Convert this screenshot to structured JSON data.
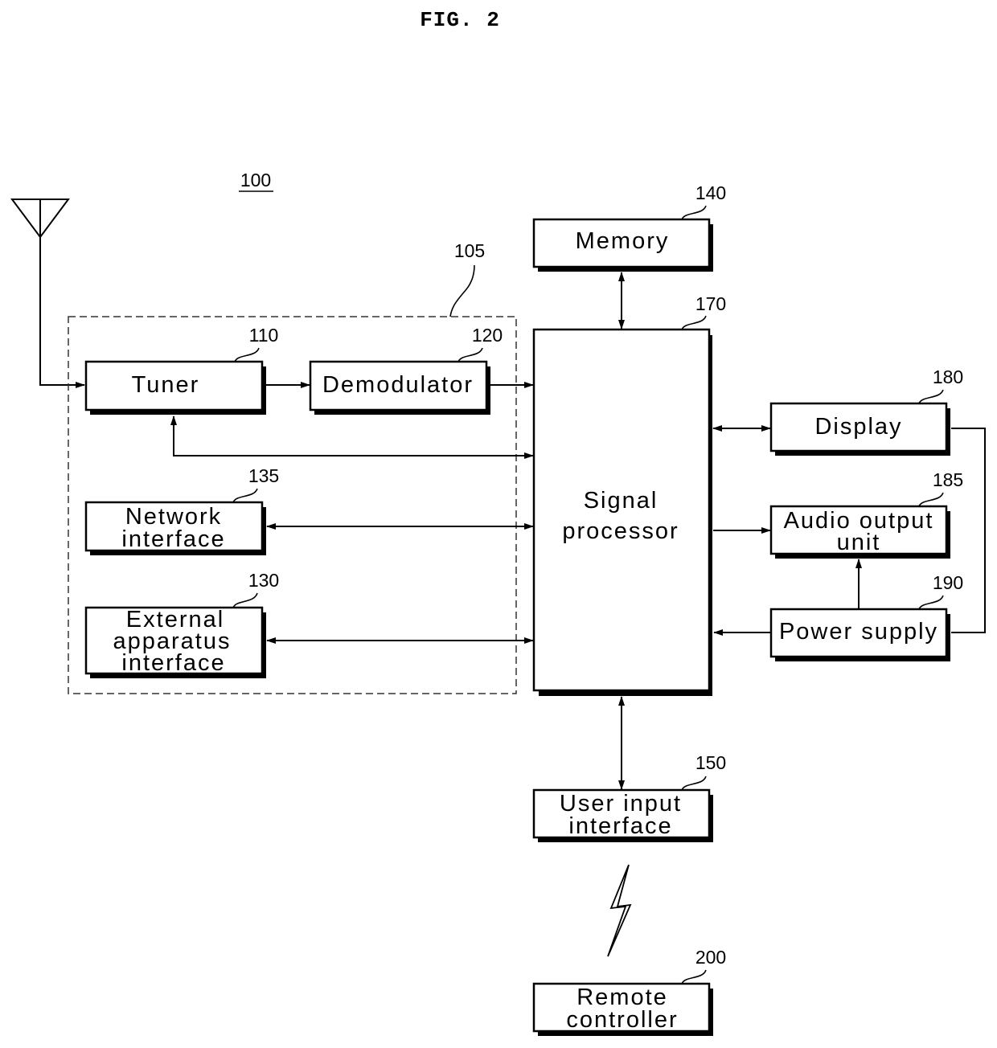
{
  "figure": {
    "title": "FIG. 2",
    "device_ref": "100",
    "group_ref": "105"
  },
  "blocks": {
    "tuner": {
      "label": [
        "Tuner"
      ],
      "ref": "110"
    },
    "demodulator": {
      "label": [
        "Demodulator"
      ],
      "ref": "120"
    },
    "network": {
      "label": [
        "Network",
        "interface"
      ],
      "ref": "135"
    },
    "external": {
      "label": [
        "External",
        "apparatus",
        "interface"
      ],
      "ref": "130"
    },
    "memory": {
      "label": [
        "Memory"
      ],
      "ref": "140"
    },
    "processor": {
      "label": [
        "Signal",
        "processor"
      ],
      "ref": "170"
    },
    "display": {
      "label": [
        "Display"
      ],
      "ref": "180"
    },
    "audio": {
      "label": [
        "Audio output",
        "unit"
      ],
      "ref": "185"
    },
    "power": {
      "label": [
        "Power supply"
      ],
      "ref": "190"
    },
    "userinput": {
      "label": [
        "User input",
        "interface"
      ],
      "ref": "150"
    },
    "remote": {
      "label": [
        "Remote",
        "controller"
      ],
      "ref": "200"
    }
  },
  "icons": {
    "antenna": "antenna-icon",
    "wireless": "wireless-link-icon"
  }
}
